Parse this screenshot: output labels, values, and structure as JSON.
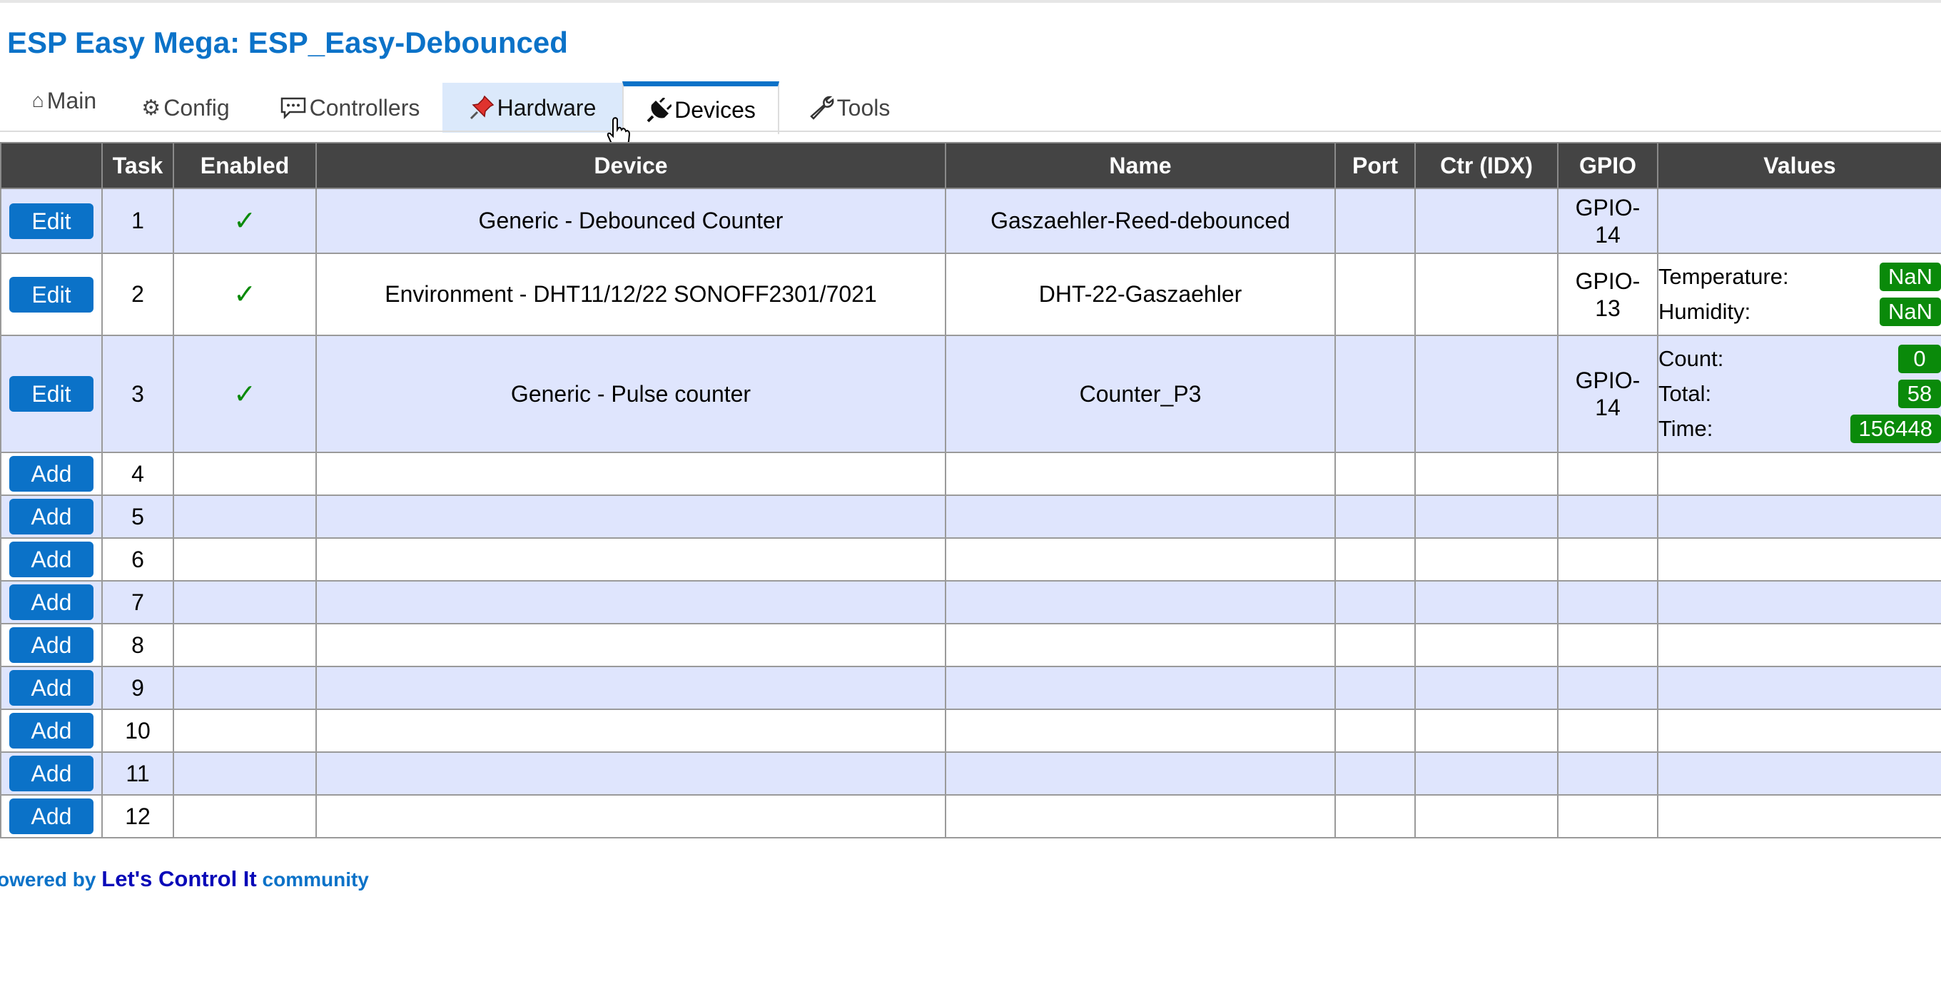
{
  "header": {
    "title": "ESP Easy Mega: ESP_Easy-Debounced"
  },
  "tabs": [
    {
      "label": "Main",
      "icon": "home-icon"
    },
    {
      "label": "Config",
      "icon": "gear-icon"
    },
    {
      "label": "Controllers",
      "icon": "speech-bubble-icon"
    },
    {
      "label": "Hardware",
      "icon": "pushpin-icon"
    },
    {
      "label": "Devices",
      "icon": "plug-icon"
    },
    {
      "label": "Tools",
      "icon": "wrench-icon"
    }
  ],
  "active_tab": "Devices",
  "hover_tab": "Hardware",
  "table": {
    "headers": [
      "",
      "Task",
      "Enabled",
      "Device",
      "Name",
      "Port",
      "Ctr (IDX)",
      "GPIO",
      "Values"
    ],
    "rows": [
      {
        "button": "Edit",
        "task": "1",
        "enabled": "✓",
        "device": "Generic - Debounced Counter",
        "name": "Gaszaehler-Reed-debounced",
        "port": "",
        "ctr": "",
        "gpio": [
          "GPIO-",
          "14"
        ],
        "values": []
      },
      {
        "button": "Edit",
        "task": "2",
        "enabled": "✓",
        "device": "Environment - DHT11/12/22 SONOFF2301/7021",
        "name": "DHT-22-Gaszaehler",
        "port": "",
        "ctr": "",
        "gpio": [
          "GPIO-",
          "13"
        ],
        "values": [
          {
            "label": "Temperature:",
            "value": "NaN"
          },
          {
            "label": "Humidity:",
            "value": "NaN"
          }
        ]
      },
      {
        "button": "Edit",
        "task": "3",
        "enabled": "✓",
        "device": "Generic - Pulse counter",
        "name": "Counter_P3",
        "port": "",
        "ctr": "",
        "gpio": [
          "GPIO-",
          "14"
        ],
        "values": [
          {
            "label": "Count:",
            "value": "0"
          },
          {
            "label": "Total:",
            "value": "58"
          },
          {
            "label": "Time:",
            "value": "156448"
          }
        ]
      },
      {
        "button": "Add",
        "task": "4"
      },
      {
        "button": "Add",
        "task": "5"
      },
      {
        "button": "Add",
        "task": "6"
      },
      {
        "button": "Add",
        "task": "7"
      },
      {
        "button": "Add",
        "task": "8"
      },
      {
        "button": "Add",
        "task": "9"
      },
      {
        "button": "Add",
        "task": "10"
      },
      {
        "button": "Add",
        "task": "11"
      },
      {
        "button": "Add",
        "task": "12"
      }
    ]
  },
  "footer": {
    "prefix": "owered by",
    "link": "Let's Control It",
    "suffix": "community"
  },
  "colors": {
    "accent": "#0b72c8",
    "header_bg": "#444444",
    "row_alt": "#dfe5fd",
    "badge": "#0a8a0a"
  }
}
